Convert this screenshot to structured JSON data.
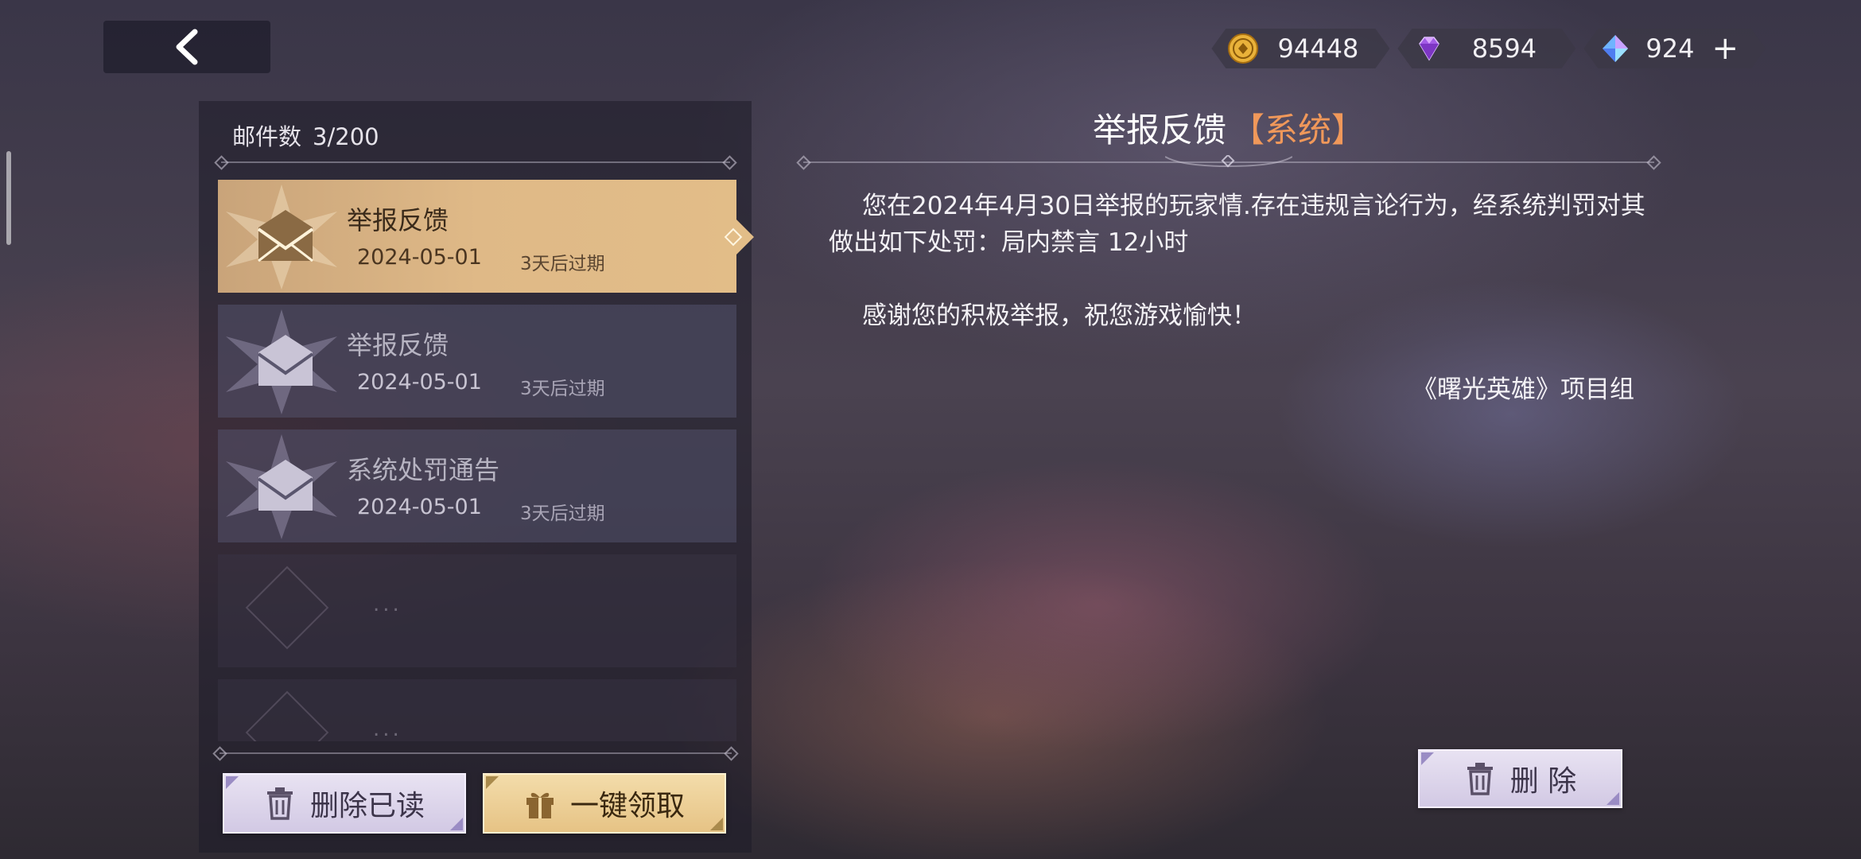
{
  "currency": {
    "gold": "94448",
    "diamond": "8594",
    "crystal": "924",
    "add_label": "+"
  },
  "mail_list": {
    "count_label": "邮件数",
    "count_value": "3/200",
    "items": [
      {
        "title": "举报反馈",
        "date": "2024-05-01",
        "expire": "3天后过期",
        "state": "selected"
      },
      {
        "title": "举报反馈",
        "date": "2024-05-01",
        "expire": "3天后过期",
        "state": "read"
      },
      {
        "title": "系统处罚通告",
        "date": "2024-05-01",
        "expire": "3天后过期",
        "state": "read"
      }
    ],
    "placeholder_text": "...",
    "delete_read_label": "删除已读",
    "claim_all_label": "一键领取"
  },
  "detail": {
    "title": "举报反馈",
    "tag": "【系统】",
    "paragraph1": "您在2024年4月30日举报的玩家情.存在违规言论行为，经系统判罚对其做出如下处罚：局内禁言 12小时",
    "paragraph2": "感谢您的积极举报，祝您游戏愉快！",
    "signature": "《曙光英雄》项目组",
    "delete_label": "删 除"
  },
  "colors": {
    "selected_item": "#e2bd88",
    "tag_orange": "#f0985a",
    "button_lilac": "#d2c9e4",
    "button_gold": "#e6c385"
  }
}
